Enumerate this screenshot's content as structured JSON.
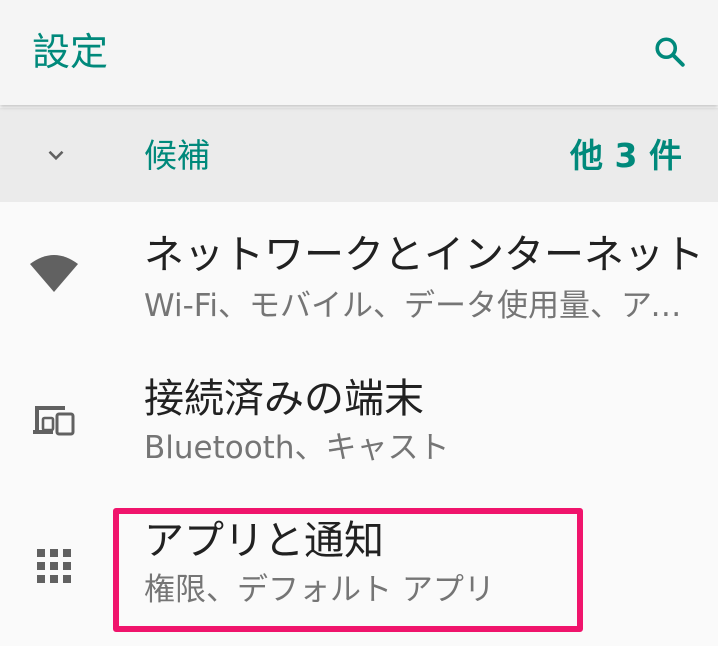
{
  "app_bar": {
    "title": "設定",
    "search_icon": "search-icon"
  },
  "suggestions": {
    "label": "候補",
    "count": "他 3 件",
    "icon": "chevron-down-icon"
  },
  "items": [
    {
      "title": "ネットワークとインターネット",
      "subtitle": "Wi-Fi、モバイル、データ使用量、アクセスポイント",
      "icon": "wifi-icon"
    },
    {
      "title": "接続済みの端末",
      "subtitle": "Bluetooth、キャスト",
      "icon": "devices-icon"
    },
    {
      "title": "アプリと通知",
      "subtitle": "権限、デフォルト アプリ",
      "icon": "apps-grid-icon"
    }
  ],
  "colors": {
    "accent": "#00897b",
    "title_text": "#212121",
    "secondary_text": "#757575",
    "icon": "#616161",
    "highlight": "#f0146c"
  }
}
